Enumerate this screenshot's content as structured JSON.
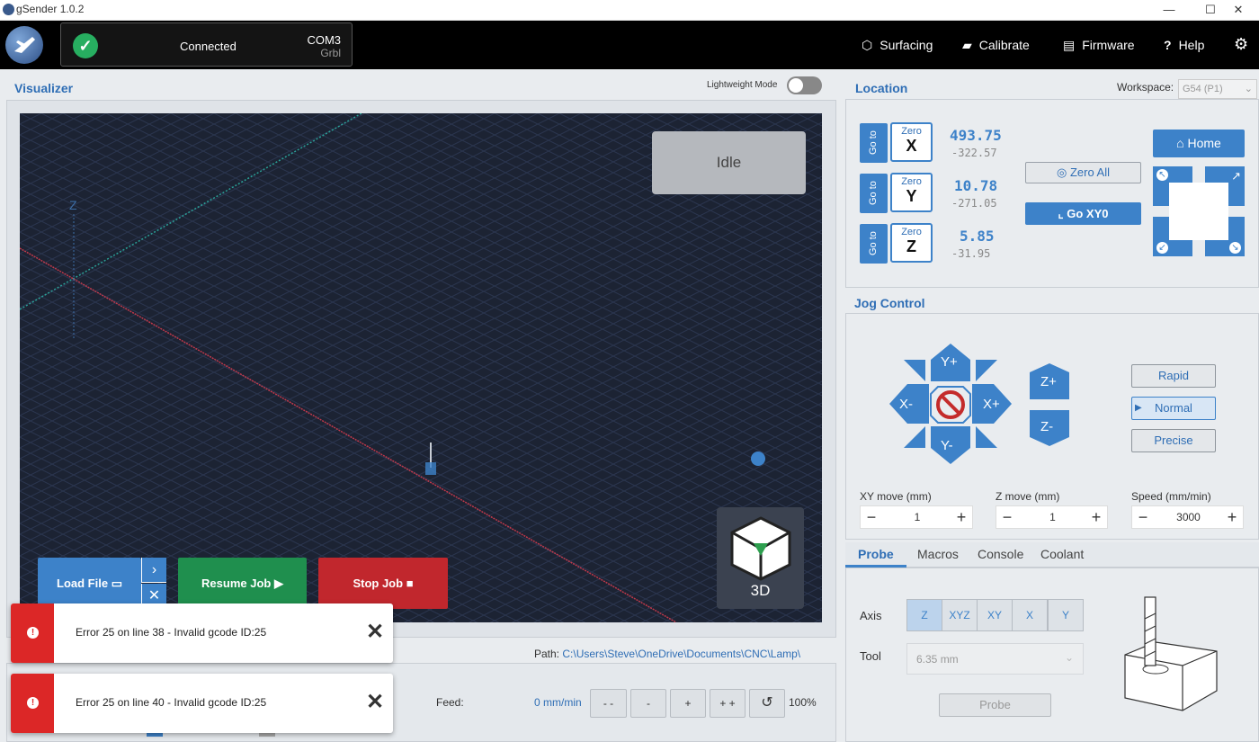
{
  "window": {
    "title": "gSender 1.0.2",
    "minimize": "—",
    "maximize": "☐",
    "close": "✕"
  },
  "header": {
    "connection": {
      "status": "Connected",
      "port": "COM3",
      "firmware": "Grbl"
    },
    "links": {
      "surfacing": "Surfacing",
      "calibrate": "Calibrate",
      "firmware": "Firmware",
      "help": "Help"
    }
  },
  "visualizer": {
    "title": "Visualizer",
    "lightweight_label": "Lightweight Mode",
    "state": "Idle",
    "axis_label": "Z",
    "view_label": "3D",
    "load_file": "Load File",
    "resume_job": "Resume Job",
    "stop_job": "Stop Job"
  },
  "notifications": [
    {
      "message": "Error 25 on line 38 - Invalid gcode ID:25"
    },
    {
      "message": "Error 25 on line 40 - Invalid gcode ID:25"
    }
  ],
  "status_bar": {
    "path_label": "Path:",
    "path": "C:\\Users\\Steve\\OneDrive\\Documents\\CNC\\Lamp\\",
    "feed_label": "Feed:",
    "feed_value": "0 mm/min",
    "btn_dec2": "- -",
    "btn_dec": "-",
    "btn_inc": "+",
    "btn_inc2": "+ +",
    "override": "100%"
  },
  "location": {
    "title": "Location",
    "workspace_label": "Workspace:",
    "workspace_value": "G54 (P1)",
    "goto_label": "Go to",
    "zero_label": "Zero",
    "axes": [
      {
        "axis": "X",
        "work": "493.75",
        "machine": "-322.57"
      },
      {
        "axis": "Y",
        "work": "10.78",
        "machine": "-271.05"
      },
      {
        "axis": "Z",
        "work": "5.85",
        "machine": "-31.95"
      }
    ],
    "zero_all": "Zero All",
    "go_xy0": "Go  XY0",
    "home": "Home"
  },
  "jog": {
    "title": "Jog Control",
    "y_plus": "Y+",
    "y_minus": "Y-",
    "x_plus": "X+",
    "x_minus": "X-",
    "z_plus": "Z+",
    "z_minus": "Z-",
    "rapid": "Rapid",
    "normal": "Normal",
    "precise": "Precise",
    "xy_label": "XY move (mm)",
    "xy_value": "1",
    "z_label": "Z move (mm)",
    "z_value": "1",
    "speed_label": "Speed (mm/min)",
    "speed_value": "3000"
  },
  "tools_tabs": {
    "probe": "Probe",
    "macros": "Macros",
    "console": "Console",
    "coolant": "Coolant"
  },
  "probe": {
    "axis_label": "Axis",
    "axis_options": [
      "Z",
      "XYZ",
      "XY",
      "X",
      "Y"
    ],
    "tool_label": "Tool",
    "tool_value": "6.35 mm",
    "probe_button": "Probe"
  },
  "colors": {
    "accent": "#3d82c9",
    "connected": "#27ae60",
    "error": "#dc2727",
    "resume": "#1f8f4e",
    "stop": "#c1272d"
  }
}
